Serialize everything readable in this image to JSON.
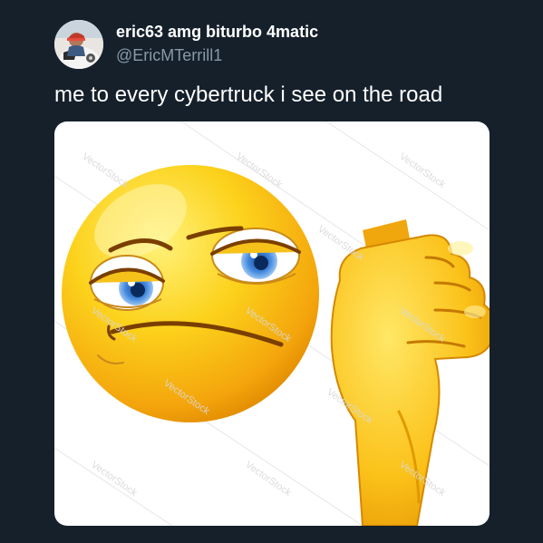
{
  "tweet": {
    "display_name": "eric63 amg biturbo 4matic",
    "handle": "@EricMTerrill1",
    "text": "me to every cybertruck i see on the road",
    "avatar_icon": "profile-photo",
    "media": {
      "subject": "thumbs-down-emoji",
      "watermark": "VectorStock",
      "colors": {
        "face": "#f9c114",
        "face_shadow": "#e08a00",
        "iris": "#4a8fe0",
        "eye_white": "#ffffff"
      }
    }
  },
  "theme": {
    "background": "#15202b",
    "name_color": "#ffffff",
    "handle_color": "#8899a6"
  }
}
